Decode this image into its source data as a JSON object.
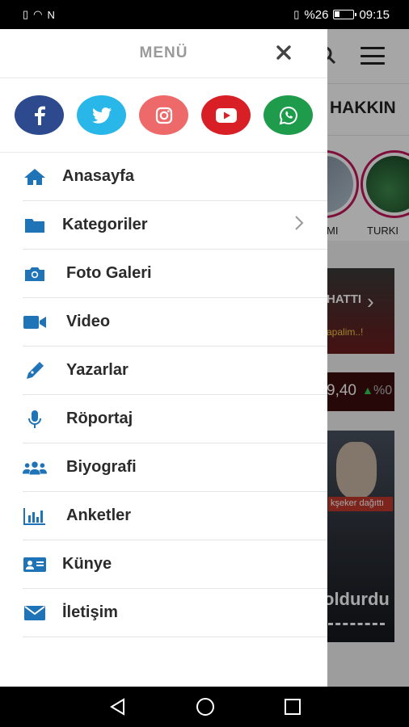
{
  "status_bar": {
    "battery": "%26",
    "time": "09:15"
  },
  "background_app": {
    "ticker": "HAKKIN",
    "stories": [
      "MI",
      "TURKI"
    ],
    "card1_title": "HATTI",
    "card1_sub": "apalim..!",
    "price_value": "9,40",
    "price_change": "%0",
    "card3_caption": "kşeker dağıttı",
    "card3_title": "oldurdu"
  },
  "drawer": {
    "title": "MENÜ",
    "social": [
      {
        "name": "facebook-icon",
        "color": "#2d4a8f"
      },
      {
        "name": "twitter-icon",
        "color": "#29b6e8"
      },
      {
        "name": "instagram-icon",
        "color": "#ee6a6a"
      },
      {
        "name": "youtube-icon",
        "color": "#d81f26"
      },
      {
        "name": "whatsapp-icon",
        "color": "#1e9c4c"
      }
    ],
    "items": [
      {
        "label": "Anasayfa",
        "icon": "home-icon"
      },
      {
        "label": "Kategoriler",
        "icon": "folder-icon"
      },
      {
        "label": "Foto Galeri",
        "icon": "camera-icon"
      },
      {
        "label": "Video",
        "icon": "video-camera-icon"
      },
      {
        "label": "Yazarlar",
        "icon": "pen-icon"
      },
      {
        "label": "Röportaj",
        "icon": "microphone-icon"
      },
      {
        "label": "Biyografi",
        "icon": "users-icon"
      },
      {
        "label": "Anketler",
        "icon": "bar-chart-icon"
      },
      {
        "label": "Künye",
        "icon": "id-card-icon"
      },
      {
        "label": "İletişim",
        "icon": "envelope-icon"
      }
    ]
  },
  "colors": {
    "accent": "#1f73b7"
  }
}
